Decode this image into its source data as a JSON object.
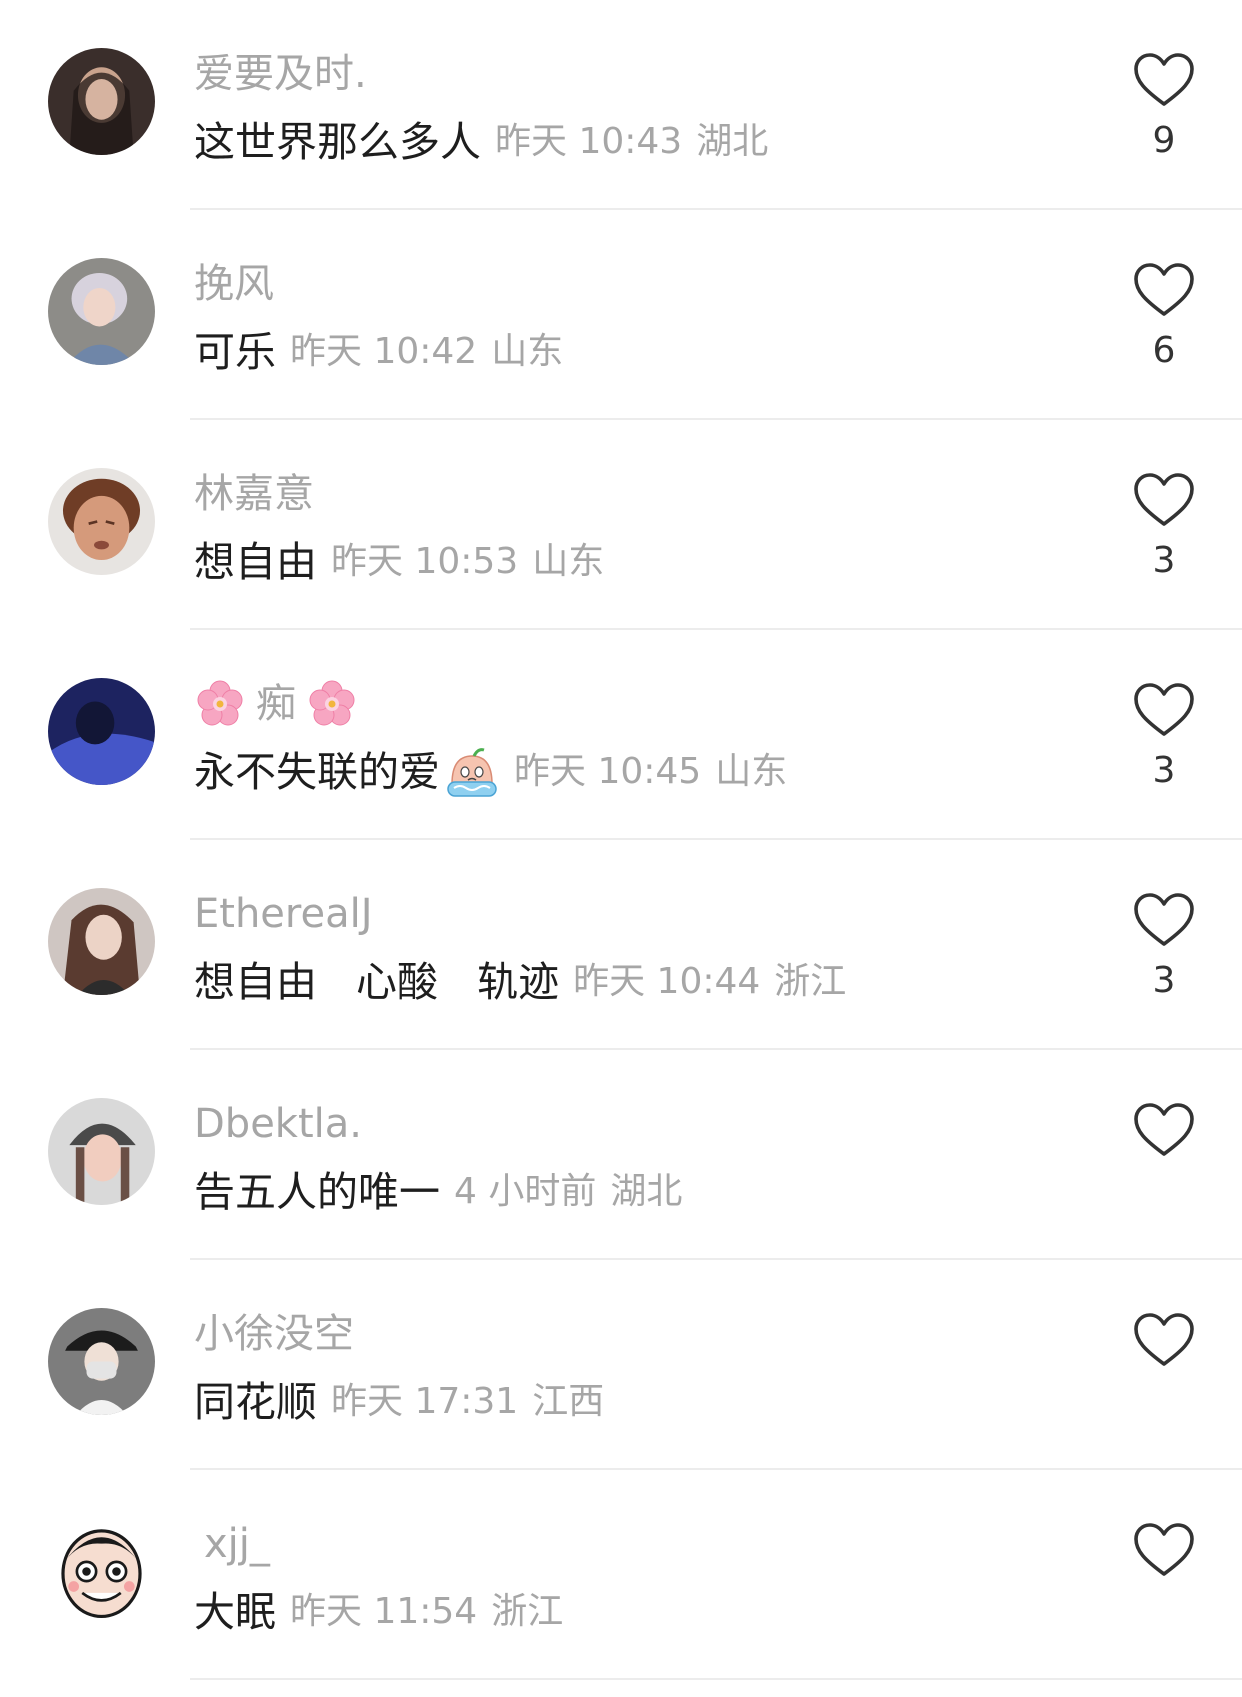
{
  "comments": [
    {
      "username": "爱要及时.",
      "body": [
        "这世界那么多人"
      ],
      "time": "昨天 10:43",
      "location": "湖北",
      "likes": "9",
      "avatar_colors": [
        "#3a2e2b",
        "#c9a38d"
      ]
    },
    {
      "username": "挽风",
      "body": [
        "可乐"
      ],
      "time": "昨天 10:42",
      "location": "山东",
      "likes": "6",
      "avatar_colors": [
        "#8d8c88",
        "#d7d2dd"
      ]
    },
    {
      "username": "林嘉意",
      "body": [
        "想自由"
      ],
      "time": "昨天 10:53",
      "location": "山东",
      "likes": "3",
      "avatar_colors": [
        "#6f3d26",
        "#d59a7b"
      ]
    },
    {
      "username": "痴",
      "username_decor": "cherry-blossom-icon",
      "body": [
        "永不失联的爱"
      ],
      "body_emoji": "crying-face-emoji",
      "time": "昨天 10:45",
      "location": "山东",
      "likes": "3",
      "avatar_colors": [
        "#1d2360",
        "#4556c8"
      ]
    },
    {
      "username": "EtherealJ",
      "body": [
        "想自由",
        "心酸",
        "轨迹"
      ],
      "time": "昨天 10:44",
      "location": "浙江",
      "likes": "3",
      "avatar_colors": [
        "#cfc6c2",
        "#ecd3c6"
      ]
    },
    {
      "username": "Dbektla.",
      "body": [
        "告五人的唯一"
      ],
      "time": "4 小时前",
      "location": "湖北",
      "likes": "",
      "avatar_colors": [
        "#4a4a4a",
        "#f1cdbf"
      ]
    },
    {
      "username": "小徐没空",
      "body": [
        "同花顺"
      ],
      "time": "昨天 17:31",
      "location": "江西",
      "likes": "",
      "avatar_colors": [
        "#7d7d7d",
        "#e4e4e4"
      ]
    },
    {
      "username": "xjj_",
      "body": [
        "大眠"
      ],
      "time": "昨天 11:54",
      "location": "浙江",
      "likes": "",
      "avatar_colors": [
        "#ffffff",
        "#1a1a1a"
      ]
    }
  ]
}
